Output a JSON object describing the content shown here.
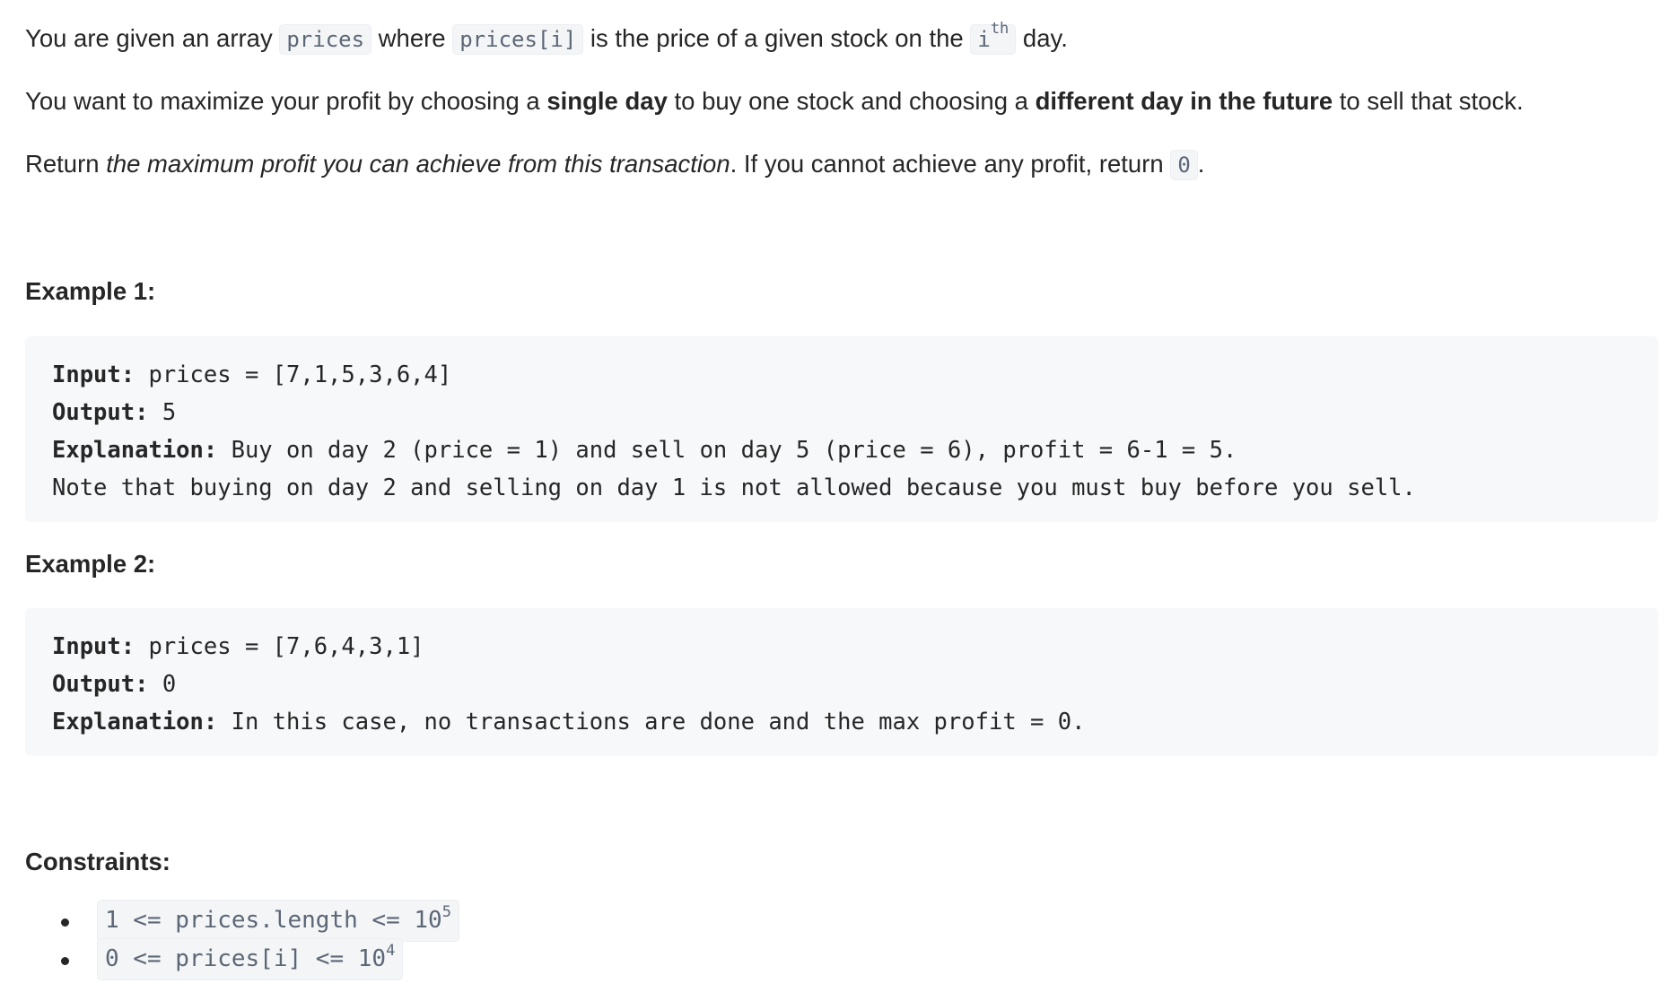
{
  "intro": {
    "p1": {
      "t1": "You are given an array ",
      "c1": "prices",
      "t2": " where ",
      "c2": "prices[i]",
      "t3": " is the price of a given stock on the ",
      "c3_base": "i",
      "c3_sup": "th",
      "t4": " day."
    },
    "p2": {
      "t1": "You want to maximize your profit by choosing a ",
      "b1": "single day",
      "t2": " to buy one stock and choosing a ",
      "b2": "different day in the future",
      "t3": " to sell that stock."
    },
    "p3": {
      "t1": "Return ",
      "i1": "the maximum profit you can achieve from this transaction",
      "t2": ". If you cannot achieve any profit, return ",
      "c1": "0",
      "t3": "."
    }
  },
  "examples": [
    {
      "heading": "Example 1:",
      "input_label": "Input:",
      "input_value": " prices = [7,1,5,3,6,4]",
      "output_label": "Output:",
      "output_value": " 5",
      "explanation_label": "Explanation:",
      "explanation_value": " Buy on day 2 (price = 1) and sell on day 5 (price = 6), profit = 6-1 = 5.",
      "note": "Note that buying on day 2 and selling on day 1 is not allowed because you must buy before you sell."
    },
    {
      "heading": "Example 2:",
      "input_label": "Input:",
      "input_value": " prices = [7,6,4,3,1]",
      "output_label": "Output:",
      "output_value": " 0",
      "explanation_label": "Explanation:",
      "explanation_value": " In this case, no transactions are done and the max profit = 0."
    }
  ],
  "constraints": {
    "heading": "Constraints:",
    "items": [
      {
        "base": "1 <= prices.length <= 10",
        "sup": "5"
      },
      {
        "base": "0 <= prices[i] <= 10",
        "sup": "4"
      }
    ]
  }
}
